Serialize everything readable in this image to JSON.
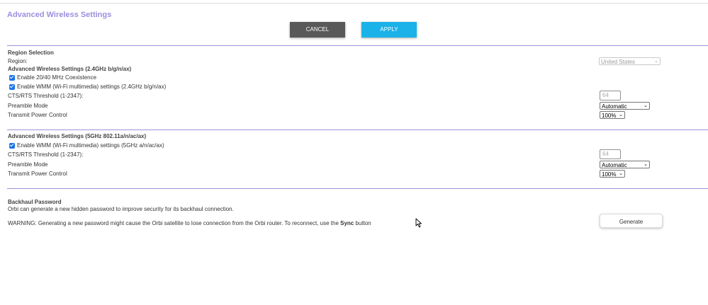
{
  "page": {
    "title": "Advanced Wireless Settings"
  },
  "buttons": {
    "cancel": "CANCEL",
    "apply": "APPLY",
    "generate": "Generate"
  },
  "region": {
    "header": "Region Selection",
    "label": "Region:",
    "value": "United States"
  },
  "band24": {
    "header": "Advanced Wireless Settings (2.4GHz b/g/n/ax)",
    "coexistence": {
      "label": "Enable 20/40 MHz Coexistence",
      "checked": true
    },
    "wmm": {
      "label": "Enable WMM (Wi-Fi multimedia) settings (2.4GHz b/g/n/ax)",
      "checked": true
    },
    "cts_label": "CTS/RTS Threshold (1-2347):",
    "cts_value": "64",
    "preamble_label": "Preamble Mode",
    "preamble_value": "Automatic",
    "power_label": "Transmit Power Control",
    "power_value": "100%"
  },
  "band5": {
    "header": "Advanced Wireless Settings (5GHz 802.11a/n/ac/ax)",
    "wmm": {
      "label": "Enable WMM (Wi-Fi multimedia) settings (5GHz a/n/ac/ax)",
      "checked": true
    },
    "cts_label": "CTS/RTS Threshold (1-2347):",
    "cts_value": "64",
    "preamble_label": "Preamble Mode",
    "preamble_value": "Automatic",
    "power_label": "Transmit Power Control",
    "power_value": "100%"
  },
  "backhaul": {
    "header": "Backhaul Password",
    "description": "Orbi can generate a new hidden password to improve security for its backhaul connection.",
    "warning_prefix": "WARNING: Generating a new password might cause the Orbi satellite to lose connection from the Orbi router. To reconnect, use the ",
    "warning_bold": "Sync",
    "warning_suffix": " button"
  },
  "colors": {
    "accent": "#9b8fe0",
    "apply": "#1ab2e8",
    "cancel": "#595959",
    "separator": "#9b92d6"
  },
  "icons": {
    "dropdown": "chevron-down-icon",
    "checkbox": "checkmark-icon",
    "cursor": "mouse-pointer-icon"
  }
}
